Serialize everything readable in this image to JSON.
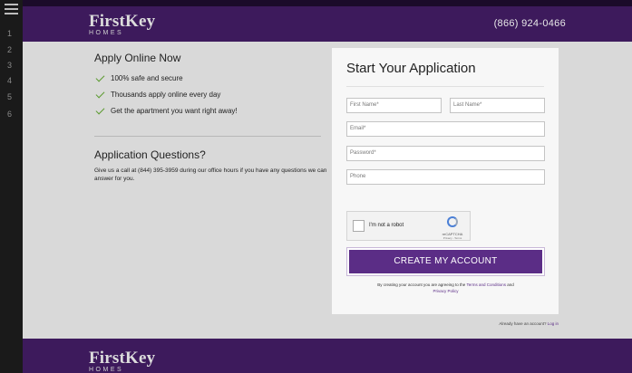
{
  "gutter": {
    "line_numbers": [
      "1",
      "2",
      "3",
      "4",
      "5",
      "6"
    ]
  },
  "header": {
    "logo_word": "FirstKey",
    "logo_sub": "HOMES",
    "phone": "(866) 924-0466"
  },
  "left": {
    "apply_title": "Apply Online Now",
    "benefits": [
      "100% safe and secure",
      "Thousands apply online every day",
      "Get the apartment you want right away!"
    ],
    "questions_title": "Application Questions?",
    "questions_text": "Give us a call at (844) 395-3959 during our office hours if you have any questions we can answer for you."
  },
  "form": {
    "title": "Start Your Application",
    "first_name_placeholder": "First Name*",
    "last_name_placeholder": "Last Name*",
    "email_placeholder": "Email*",
    "password_placeholder": "Password*",
    "phone_placeholder": "Phone",
    "captcha_label": "I'm not a robot",
    "captcha_brand": "reCAPTCHA",
    "captcha_links": "Privacy - Terms",
    "submit_label": "CREATE MY ACCOUNT",
    "terms_prefix": "By creating your account you are agreeing to the",
    "terms_link": "Terms and Conditions",
    "terms_and": "and",
    "privacy_link": "Privacy Policy"
  },
  "login": {
    "prompt": "Already have an account?",
    "link": "Log in"
  },
  "footer": {
    "logo_word": "FirstKey",
    "logo_sub": "HOMES"
  },
  "colors": {
    "brand_purple": "#3d1a5c",
    "button_purple": "#5b2d86",
    "check_green": "#5a9a2e"
  }
}
